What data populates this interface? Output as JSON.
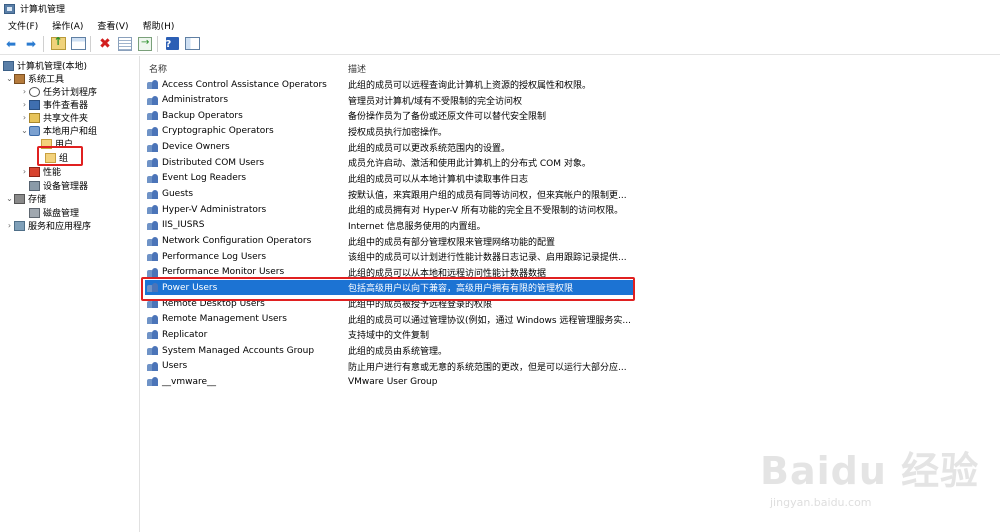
{
  "window": {
    "title": "计算机管理"
  },
  "menu": [
    "文件(F)",
    "操作(A)",
    "查看(V)",
    "帮助(H)"
  ],
  "toolbar": {
    "icons": [
      "back-icon",
      "forward-icon",
      "up-icon",
      "show-hide-tree-icon",
      "delete-icon",
      "properties-icon",
      "export-icon",
      "help-icon",
      "view-icon"
    ]
  },
  "tree": {
    "root": "计算机管理(本地)",
    "system_tools": "系统工具",
    "task_scheduler": "任务计划程序",
    "event_viewer": "事件查看器",
    "shared_folders": "共享文件夹",
    "local_users_groups": "本地用户和组",
    "users": "用户",
    "groups": "组",
    "performance": "性能",
    "device_manager": "设备管理器",
    "storage": "存储",
    "disk_management": "磁盘管理",
    "services_apps": "服务和应用程序"
  },
  "list": {
    "col_name": "名称",
    "col_desc": "描述",
    "rows": [
      {
        "name": "Access Control Assistance Operators",
        "desc": "此组的成员可以远程查询此计算机上资源的授权属性和权限。"
      },
      {
        "name": "Administrators",
        "desc": "管理员对计算机/域有不受限制的完全访问权"
      },
      {
        "name": "Backup Operators",
        "desc": "备份操作员为了备份或还原文件可以替代安全限制"
      },
      {
        "name": "Cryptographic Operators",
        "desc": "授权成员执行加密操作。"
      },
      {
        "name": "Device Owners",
        "desc": "此组的成员可以更改系统范围内的设置。"
      },
      {
        "name": "Distributed COM Users",
        "desc": "成员允许启动、激活和使用此计算机上的分布式 COM 对象。"
      },
      {
        "name": "Event Log Readers",
        "desc": "此组的成员可以从本地计算机中读取事件日志"
      },
      {
        "name": "Guests",
        "desc": "按默认值，来宾跟用户组的成员有同等访问权，但来宾帐户的限制更..."
      },
      {
        "name": "Hyper-V Administrators",
        "desc": "此组的成员拥有对 Hyper-V 所有功能的完全且不受限制的访问权限。"
      },
      {
        "name": "IIS_IUSRS",
        "desc": "Internet 信息服务使用的内置组。"
      },
      {
        "name": "Network Configuration Operators",
        "desc": "此组中的成员有部分管理权限来管理网络功能的配置"
      },
      {
        "name": "Performance Log Users",
        "desc": "该组中的成员可以计划进行性能计数器日志记录、启用跟踪记录提供..."
      },
      {
        "name": "Performance Monitor Users",
        "desc": "此组的成员可以从本地和远程访问性能计数器数据"
      },
      {
        "name": "Power Users",
        "desc": "包括高级用户以向下兼容，高级用户拥有有限的管理权限"
      },
      {
        "name": "Remote Desktop Users",
        "desc": "此组中的成员被授予远程登录的权限"
      },
      {
        "name": "Remote Management Users",
        "desc": "此组的成员可以通过管理协议(例如，通过 Windows 远程管理服务实..."
      },
      {
        "name": "Replicator",
        "desc": "支持域中的文件复制"
      },
      {
        "name": "System Managed Accounts Group",
        "desc": "此组的成员由系统管理。"
      },
      {
        "name": "Users",
        "desc": "防止用户进行有意或无意的系统范围的更改，但是可以运行大部分应..."
      },
      {
        "name": "__vmware__",
        "desc": "VMware User Group"
      }
    ],
    "selected_index": 13
  },
  "watermark": {
    "brand": "Baidu 经验",
    "url": "jingyan.baidu.com"
  },
  "colors": {
    "selection": "#1c73d3",
    "highlight_box": "#e02020"
  }
}
